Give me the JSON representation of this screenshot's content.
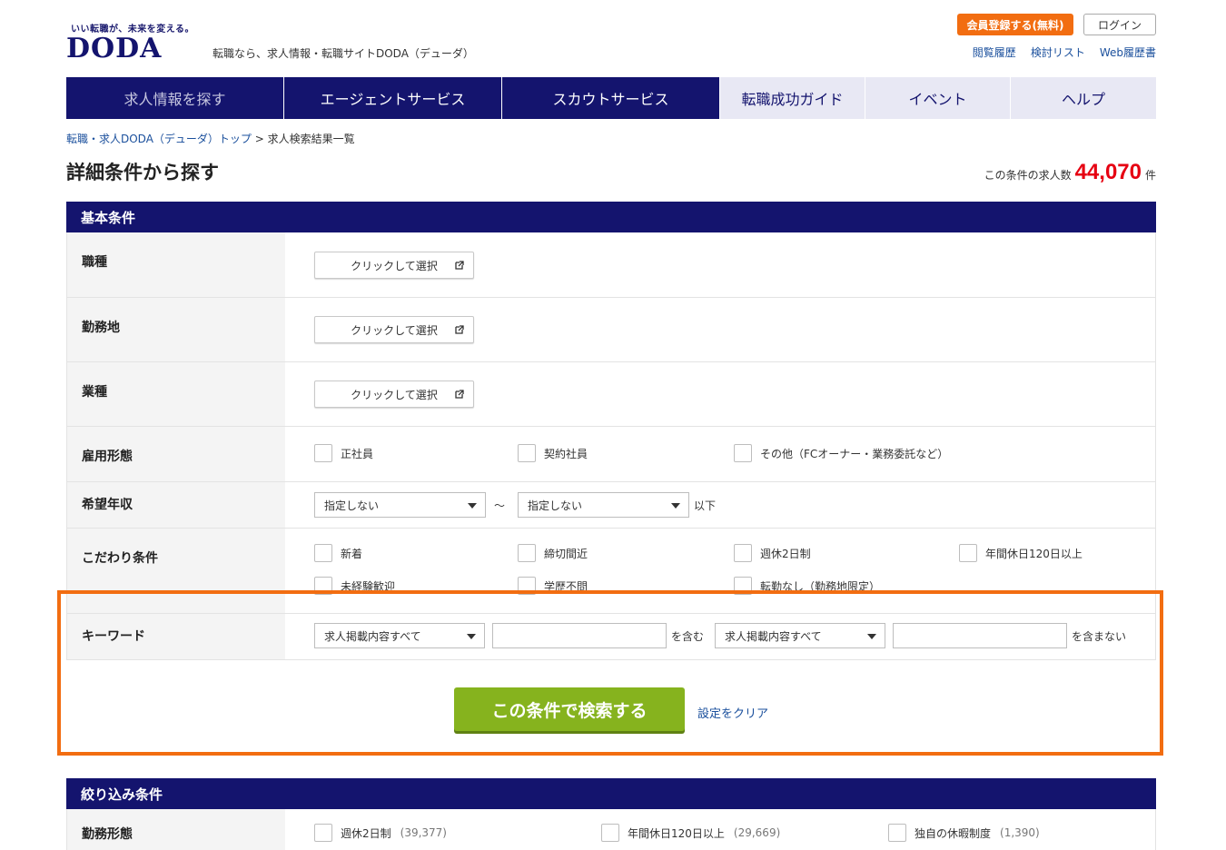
{
  "header": {
    "tagline": "いい転職が、未来を変える。",
    "logo": "DODA",
    "description": "転職なら、求人情報・転職サイトDODA（デューダ）",
    "register_button": "会員登録する(無料)",
    "login_button": "ログイン",
    "links": [
      "閲覧履歴",
      "検討リスト",
      "Web履歴書"
    ]
  },
  "nav": {
    "tabs": [
      "求人情報を探す",
      "エージェントサービス",
      "スカウトサービス",
      "転職成功ガイド",
      "イベント",
      "ヘルプ"
    ]
  },
  "breadcrumb": {
    "home": "転職・求人DODA（デューダ）トップ",
    "separator": ">",
    "current": "求人検索結果一覧"
  },
  "page_title": "詳細条件から探す",
  "result_count": {
    "prefix": "この条件の求人数",
    "value": "44,070",
    "suffix": "件"
  },
  "basic": {
    "heading": "基本条件",
    "select_label": "クリックして選択",
    "occupation_label": "職種",
    "location_label": "勤務地",
    "industry_label": "業種",
    "employment_label": "雇用形態",
    "employment_options": [
      "正社員",
      "契約社員",
      "その他（FCオーナー・業務委託など）"
    ],
    "salary_label": "希望年収",
    "salary_min": "指定しない",
    "salary_tilde": "～",
    "salary_max": "指定しない",
    "salary_suffix": "以下",
    "features_label": "こだわり条件",
    "features_row1": [
      "新着",
      "締切間近",
      "週休2日制",
      "年間休日120日以上"
    ],
    "features_row2": [
      "未経験歓迎",
      "学歴不問",
      "転勤なし（勤務地限定）"
    ],
    "keyword_label": "キーワード",
    "keyword_scope_include": "求人掲載内容すべて",
    "keyword_include_suffix": "を含む",
    "keyword_scope_exclude": "求人掲載内容すべて",
    "keyword_exclude_suffix": "を含まない",
    "search_button": "この条件で検索する",
    "clear_link": "設定をクリア"
  },
  "narrow": {
    "heading": "絞り込み条件",
    "workstyle_label": "勤務形態",
    "options": [
      {
        "label": "週休2日制",
        "count": "(39,377)"
      },
      {
        "label": "年間休日120日以上",
        "count": "(29,669)"
      },
      {
        "label": "独自の休暇制度",
        "count": "(1,390)"
      }
    ]
  },
  "colors": {
    "navy": "#14146e",
    "orange": "#f26d11",
    "green": "#86b31e",
    "count_red": "#e60012"
  }
}
